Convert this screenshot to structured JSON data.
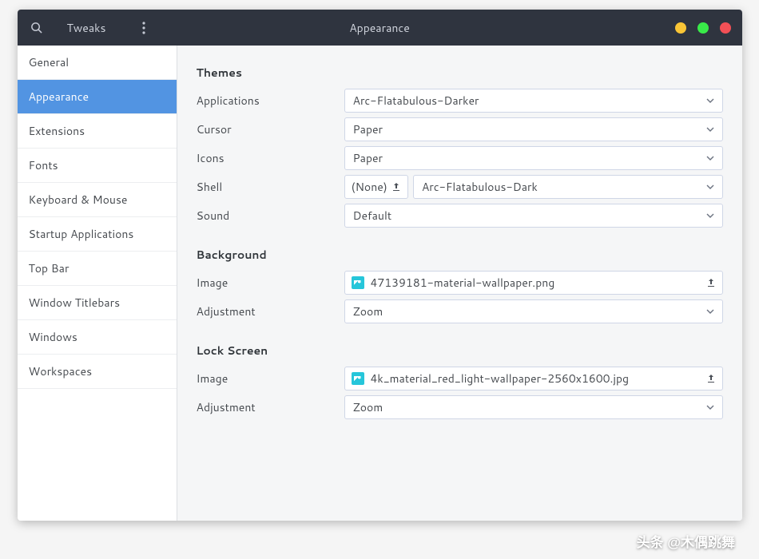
{
  "header": {
    "app_name": "Tweaks",
    "title": "Appearance"
  },
  "sidebar": {
    "items": [
      {
        "label": "General",
        "active": false
      },
      {
        "label": "Appearance",
        "active": true
      },
      {
        "label": "Extensions",
        "active": false
      },
      {
        "label": "Fonts",
        "active": false
      },
      {
        "label": "Keyboard & Mouse",
        "active": false
      },
      {
        "label": "Startup Applications",
        "active": false
      },
      {
        "label": "Top Bar",
        "active": false
      },
      {
        "label": "Window Titlebars",
        "active": false
      },
      {
        "label": "Windows",
        "active": false
      },
      {
        "label": "Workspaces",
        "active": false
      }
    ]
  },
  "sections": {
    "themes": {
      "title": "Themes",
      "applications": {
        "label": "Applications",
        "value": "Arc-Flatabulous-Darker"
      },
      "cursor": {
        "label": "Cursor",
        "value": "Paper"
      },
      "icons": {
        "label": "Icons",
        "value": "Paper"
      },
      "shell": {
        "label": "Shell",
        "none_btn": "(None)",
        "value": "Arc-Flatabulous-Dark"
      },
      "sound": {
        "label": "Sound",
        "value": "Default"
      }
    },
    "background": {
      "title": "Background",
      "image": {
        "label": "Image",
        "value": "47139181-material-wallpaper.png"
      },
      "adjustment": {
        "label": "Adjustment",
        "value": "Zoom"
      }
    },
    "lockscreen": {
      "title": "Lock Screen",
      "image": {
        "label": "Image",
        "value": "4k_material_red_light-wallpaper-2560x1600.jpg"
      },
      "adjustment": {
        "label": "Adjustment",
        "value": "Zoom"
      }
    }
  },
  "watermark": "头条 @木偶跳舞"
}
